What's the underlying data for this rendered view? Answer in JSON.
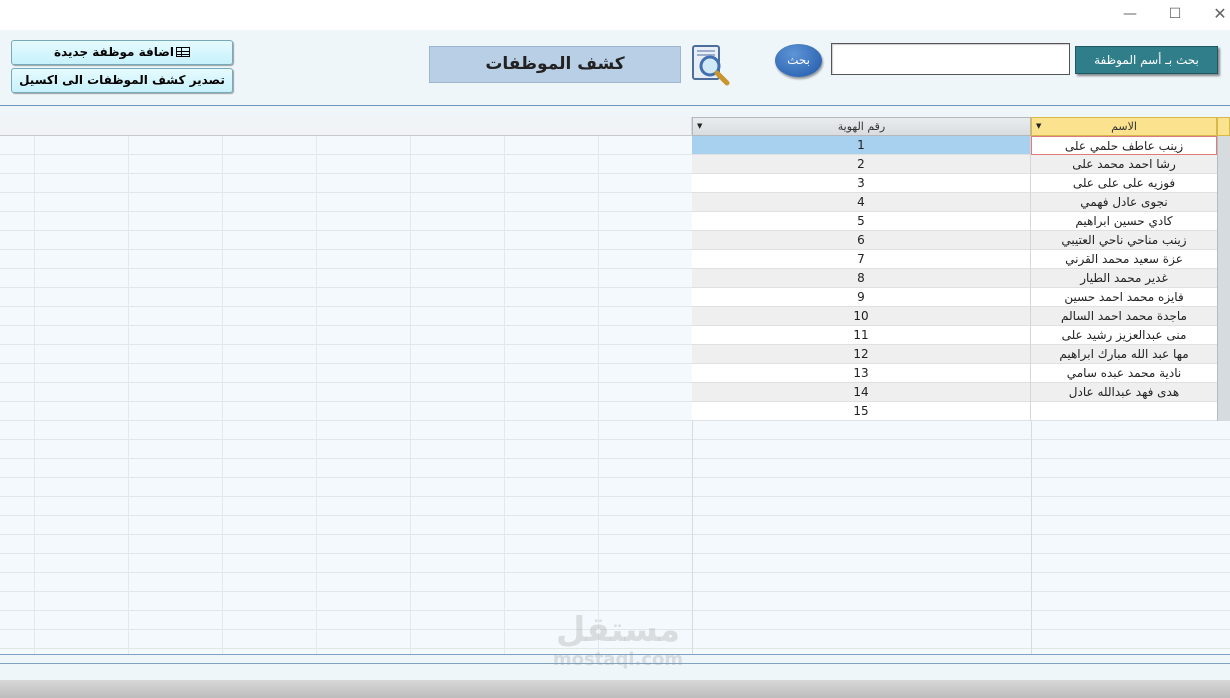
{
  "window": {
    "minimize_glyph": "—",
    "maximize_glyph": "☐",
    "close_glyph": "✕"
  },
  "toolbar": {
    "add_employee_label": "اضافة موظفة جديدة",
    "export_label": "تصدير كشف الموظفات الى اكسيل",
    "form_title": "كشف الموظفات",
    "search_button_label": "بحث",
    "search_input_value": "",
    "search_by_name_label": "بحث بـ أسم الموظفة"
  },
  "icons": {
    "add": "table-icon",
    "title": "magnifier-icon"
  },
  "grid": {
    "columns": {
      "name": "الاسم",
      "id": "رقم الهوية"
    },
    "selected_row": 0,
    "rows": [
      {
        "id": "1",
        "name": "زينب عاطف حلمي على"
      },
      {
        "id": "2",
        "name": "رشا احمد محمد على"
      },
      {
        "id": "3",
        "name": "فوزيه على على على"
      },
      {
        "id": "4",
        "name": "نجوى عادل فهمي"
      },
      {
        "id": "5",
        "name": "كادي حسين ابراهيم"
      },
      {
        "id": "6",
        "name": "زينب مناحي ناحي العتيبي"
      },
      {
        "id": "7",
        "name": "عزة سعيد محمد القرني"
      },
      {
        "id": "8",
        "name": "غدير محمد الطيار"
      },
      {
        "id": "9",
        "name": "فايزه محمد احمد حسين"
      },
      {
        "id": "10",
        "name": "ماجدة محمد احمد السالم"
      },
      {
        "id": "11",
        "name": "منى عبدالعزيز رشيد على"
      },
      {
        "id": "12",
        "name": "مها عبد الله مبارك ابراهيم"
      },
      {
        "id": "13",
        "name": "نادية محمد عبده سامي"
      },
      {
        "id": "14",
        "name": "هدى فهد عبدالله عادل"
      },
      {
        "id": "15",
        "name": ""
      }
    ]
  },
  "watermark": {
    "arabic": "مستقل",
    "latin": "mostaql.com"
  },
  "colors": {
    "form_bg": "#eef6fa",
    "title_bg": "#b9cfe6",
    "search_label_bg": "#2f7e8a",
    "search_button_bg": "#1f57a8",
    "header_highlight": "#fbe28f",
    "selected_cell": "#a8d0ef"
  }
}
